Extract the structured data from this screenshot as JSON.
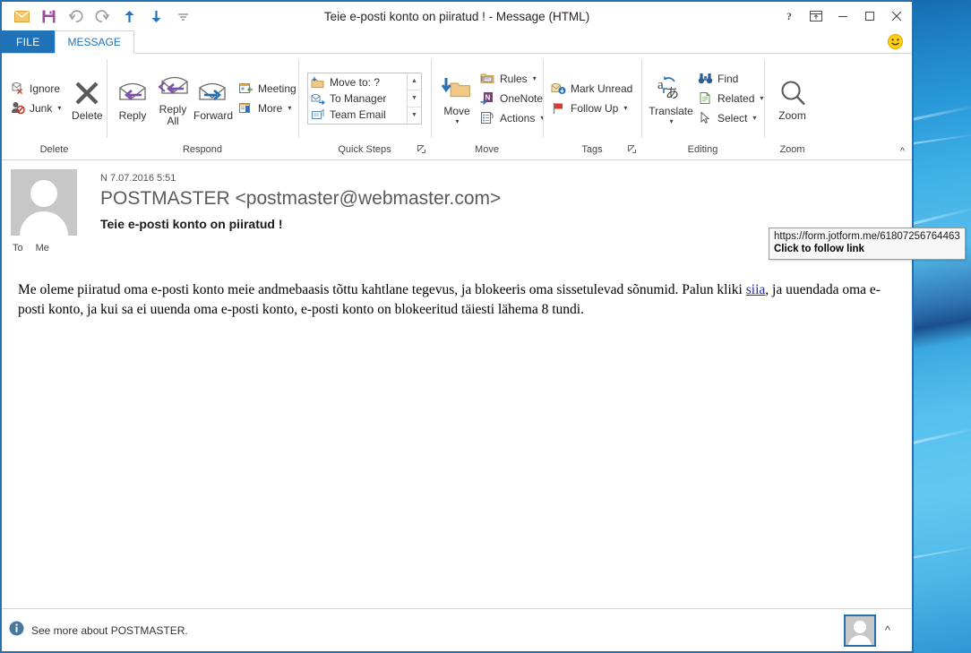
{
  "window": {
    "title": "Teie e-posti konto on piiratud ! - Message (HTML)",
    "quick_access": [
      {
        "name": "envelope-icon",
        "label": "Send / Message"
      },
      {
        "name": "save-icon",
        "label": "Save"
      },
      {
        "name": "undo-icon",
        "label": "Undo"
      },
      {
        "name": "redo-icon",
        "label": "Redo"
      },
      {
        "name": "previous-item-icon",
        "label": "Previous Item"
      },
      {
        "name": "next-item-icon",
        "label": "Next Item"
      },
      {
        "name": "customize-qat-icon",
        "label": "Customize Quick Access Toolbar"
      }
    ],
    "controls": {
      "help": "?",
      "restore_down": "Restore Down",
      "minimize": "Minimize",
      "maximize": "Maximize",
      "close": "Close"
    }
  },
  "tabs": {
    "file": "FILE",
    "items": [
      {
        "label": "MESSAGE",
        "active": true
      }
    ],
    "smiley": "Send a Smile"
  },
  "ribbon": {
    "collapse_label": "^",
    "groups": [
      {
        "label": "Delete",
        "buttons": [
          {
            "label": "Ignore",
            "icon": "ignore-icon",
            "type": "small"
          },
          {
            "label": "Junk",
            "icon": "junk-icon",
            "type": "small",
            "caret": true
          },
          {
            "label": "Delete",
            "icon": "delete-x-icon",
            "type": "big"
          }
        ]
      },
      {
        "label": "Respond",
        "buttons": [
          {
            "label": "Reply",
            "icon": "reply-icon",
            "type": "big"
          },
          {
            "label": "Reply All",
            "icon": "reply-all-icon",
            "type": "big"
          },
          {
            "label": "Forward",
            "icon": "forward-icon",
            "type": "big"
          },
          {
            "label": "Meeting",
            "icon": "meeting-icon",
            "type": "small"
          },
          {
            "label": "More",
            "icon": "more-respond-icon",
            "type": "small",
            "caret": true
          }
        ]
      },
      {
        "label": "Quick Steps",
        "has_dialog_launcher": true,
        "gallery": [
          {
            "label": "Move to: ?",
            "icon": "move-to-folder-icon"
          },
          {
            "label": "To Manager",
            "icon": "to-manager-icon"
          },
          {
            "label": "Team Email",
            "icon": "team-email-icon"
          }
        ],
        "scroll": [
          "scroll-up-icon",
          "scroll-down-icon",
          "more-gallery-icon"
        ]
      },
      {
        "label": "Move",
        "buttons": [
          {
            "label": "Move",
            "icon": "move-folder-icon",
            "type": "big",
            "caret": true
          },
          {
            "label": "Rules",
            "icon": "rules-icon",
            "type": "small",
            "caret": true
          },
          {
            "label": "OneNote",
            "icon": "onenote-icon",
            "type": "small"
          },
          {
            "label": "Actions",
            "icon": "actions-icon",
            "type": "small",
            "caret": true
          }
        ]
      },
      {
        "label": "Tags",
        "has_dialog_launcher": true,
        "buttons": [
          {
            "label": "Mark Unread",
            "icon": "mark-unread-icon",
            "type": "small"
          },
          {
            "label": "Follow Up",
            "icon": "follow-up-flag-icon",
            "type": "small",
            "caret": true
          }
        ]
      },
      {
        "label": "Editing",
        "buttons": [
          {
            "label": "Translate",
            "icon": "translate-icon",
            "type": "big",
            "caret": true
          },
          {
            "label": "Find",
            "icon": "find-binoculars-icon",
            "type": "small"
          },
          {
            "label": "Related",
            "icon": "related-icon",
            "type": "small",
            "caret": true
          },
          {
            "label": "Select",
            "icon": "select-cursor-icon",
            "type": "small",
            "caret": true
          }
        ]
      },
      {
        "label": "Zoom",
        "buttons": [
          {
            "label": "Zoom",
            "icon": "zoom-magnifier-icon",
            "type": "big"
          }
        ]
      }
    ]
  },
  "message": {
    "date": "N 7.07.2016 5:51",
    "from": "POSTMASTER <postmaster@webmaster.com>",
    "subject": "Teie e-posti konto on piiratud !",
    "to_label": "To",
    "to_value": "Me",
    "body": {
      "before_link": "Me oleme piiratud oma e-posti konto meie andmebaasis tõttu kahtlane tegevus, ja blokeeris oma sissetulevad sõnumid. Palun kliki ",
      "link_text": "siia",
      "after_link": ", ja uuendada oma e-posti konto, ja kui sa ei uuenda oma e-posti konto, e-posti konto on blokeeritud täiesti lähema 8 tundi."
    }
  },
  "tooltip": {
    "url": "https://form.jotform.me/61807256764463",
    "hint": "Click to follow link"
  },
  "status": {
    "info_text": "See more about POSTMASTER.",
    "expand_label": "^"
  },
  "colors": {
    "accent": "#2072b8",
    "window_border": "#2a6fad",
    "link": "#2222aa",
    "ribbon_bg": "#ffffff"
  }
}
